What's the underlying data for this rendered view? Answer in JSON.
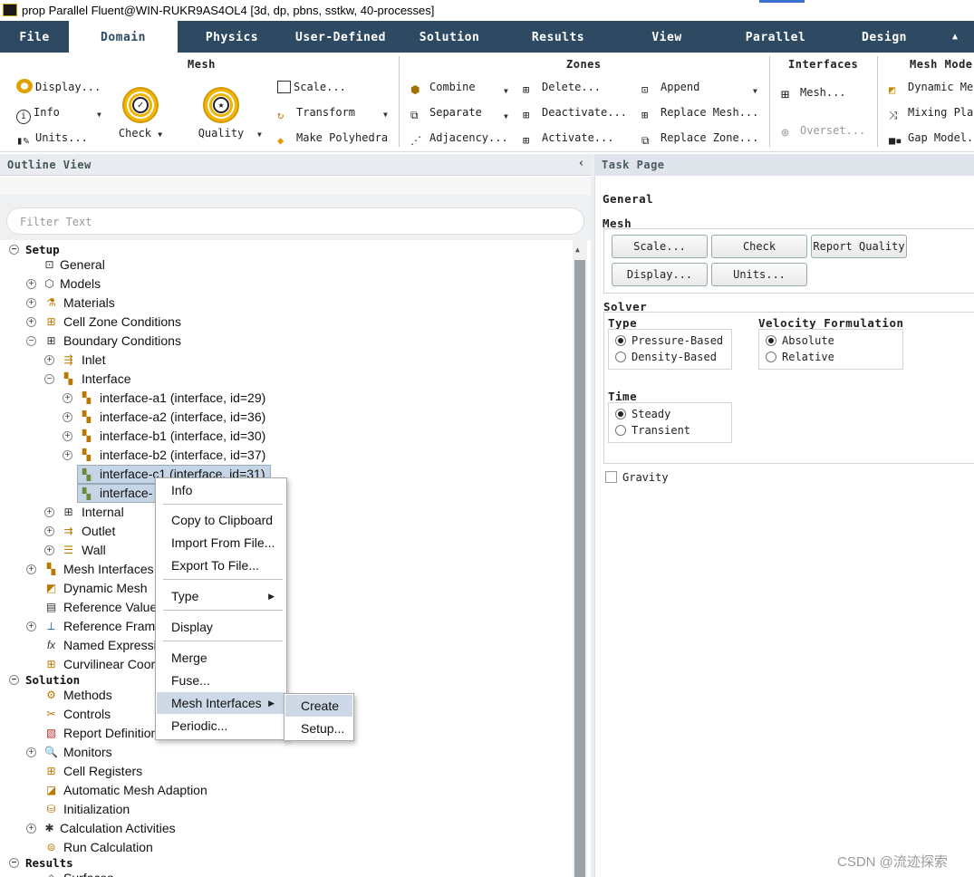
{
  "window": {
    "title": "prop Parallel Fluent@WIN-RUKR9AS4OL4  [3d, dp, pbns, sstkw, 40-processes]"
  },
  "menu_tabs": [
    "File",
    "Domain",
    "Physics",
    "User-Defined",
    "Solution",
    "Results",
    "View",
    "Parallel",
    "Design"
  ],
  "active_tab": "Domain",
  "ribbon": {
    "mesh": {
      "title": "Mesh",
      "display": "Display...",
      "info": "Info",
      "units": "Units...",
      "check": "Check",
      "quality": "Quality",
      "scale": "Scale...",
      "transform": "Transform",
      "make_polyhedra": "Make Polyhedra"
    },
    "zones": {
      "title": "Zones",
      "combine": "Combine",
      "separate": "Separate",
      "adjacency": "Adjacency...",
      "delete": "Delete...",
      "deactivate": "Deactivate...",
      "activate": "Activate...",
      "append": "Append",
      "replace_mesh": "Replace Mesh...",
      "replace_zone": "Replace Zone..."
    },
    "interfaces": {
      "title": "Interfaces",
      "mesh": "Mesh...",
      "overset": "Overset..."
    },
    "mesh_models": {
      "title": "Mesh Mode",
      "dynamic": "Dynamic Me",
      "mixing": "Mixing Pla",
      "gap": "Gap Model."
    }
  },
  "outline": {
    "title": "Outline View",
    "filter_placeholder": "Filter Text"
  },
  "tree": [
    "Setup",
    "General",
    "Models",
    "Materials",
    "Cell Zone Conditions",
    "Boundary Conditions",
    "Inlet",
    "Interface",
    "interface-a1 (interface, id=29)",
    "interface-a2 (interface, id=36)",
    "interface-b1 (interface, id=30)",
    "interface-b2 (interface, id=37)",
    "interface-c1 (interface, id=31)",
    "interface-",
    "Internal",
    "Outlet",
    "Wall",
    "Mesh Interfaces",
    "Dynamic Mesh",
    "Reference Value",
    "Reference Frame",
    "Named Expressi",
    "Curvilinear Coor",
    "Solution",
    "Methods",
    "Controls",
    "Report Definition",
    "Monitors",
    "Cell Registers",
    "Automatic Mesh Adaption",
    "Initialization",
    "Calculation Activities",
    "Run Calculation",
    "Results",
    "Surfaces"
  ],
  "context_menu": [
    "Info",
    "Copy to Clipboard",
    "Import From File...",
    "Export To File...",
    "Type",
    "Display",
    "Merge",
    "Fuse...",
    "Mesh Interfaces",
    "Periodic..."
  ],
  "submenu": [
    "Create",
    "Setup..."
  ],
  "task": {
    "title": "Task Page",
    "general": "General",
    "mesh_label": "Mesh",
    "buttons": [
      "Scale...",
      "Check",
      "Report Quality",
      "Display...",
      "Units..."
    ],
    "solver": "Solver",
    "type_label": "Type",
    "type_options": [
      "Pressure-Based",
      "Density-Based"
    ],
    "velocity_label": "Velocity Formulation",
    "velocity_options": [
      "Absolute",
      "Relative"
    ],
    "time_label": "Time",
    "time_options": [
      "Steady",
      "Transient"
    ],
    "gravity": "Gravity"
  },
  "watermark": "CSDN @流迹探索"
}
